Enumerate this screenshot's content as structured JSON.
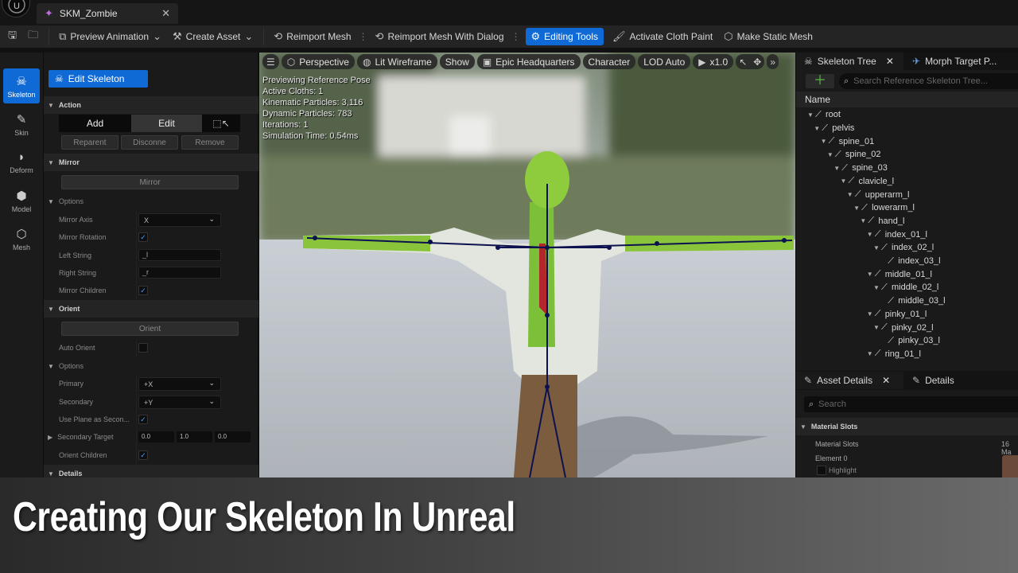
{
  "window": {
    "tab_title": "SKM_Zombie"
  },
  "toolbar": {
    "preview_animation": "Preview Animation",
    "create_asset": "Create Asset",
    "reimport_mesh": "Reimport Mesh",
    "reimport_mesh_dialog": "Reimport Mesh With Dialog",
    "editing_tools": "Editing Tools",
    "activate_cloth_paint": "Activate Cloth Paint",
    "make_static_mesh": "Make Static Mesh"
  },
  "modes": [
    "Skeleton",
    "Skin",
    "Deform",
    "Model",
    "Mesh"
  ],
  "left_panel": {
    "edit_skeleton": "Edit Skeleton",
    "action_header": "Action",
    "add": "Add",
    "edit": "Edit",
    "reparent": "Reparent",
    "disconnect": "Disconne",
    "remove": "Remove",
    "mirror_header": "Mirror",
    "mirror_button": "Mirror",
    "options_header": "Options",
    "mirror_axis_label": "Mirror Axis",
    "mirror_axis_value": "X",
    "mirror_rotation_label": "Mirror Rotation",
    "left_string_label": "Left String",
    "left_string_value": "_l",
    "right_string_label": "Right String",
    "right_string_value": "_r",
    "mirror_children_label": "Mirror Children",
    "orient_header": "Orient",
    "orient_button": "Orient",
    "auto_orient_label": "Auto Orient",
    "options2_header": "Options",
    "primary_label": "Primary",
    "primary_value": "+X",
    "secondary_label": "Secondary",
    "secondary_value": "+Y",
    "use_plane_label": "Use Plane as Secon...",
    "secondary_target_label": "Secondary Target",
    "secondary_target": [
      "0.0",
      "1.0",
      "0.0"
    ],
    "orient_children_label": "Orient Children",
    "details_header": "Details"
  },
  "viewport": {
    "perspective": "Perspective",
    "lit_wireframe": "Lit Wireframe",
    "show": "Show",
    "epic_hq": "Epic Headquarters",
    "character": "Character",
    "lod": "LOD Auto",
    "speed": "x1.0",
    "stats": [
      "Previewing Reference Pose",
      "Active Cloths: 1",
      "Kinematic Particles: 3,116",
      "Dynamic Particles: 783",
      "Iterations: 1",
      "Simulation Time: 0.54ms"
    ]
  },
  "skeleton_tree": {
    "tab": "Skeleton Tree",
    "tab2": "Morph Target P...",
    "search_placeholder": "Search Reference Skeleton Tree...",
    "column": "Name",
    "bones": [
      "root",
      "pelvis",
      "spine_01",
      "spine_02",
      "spine_03",
      "clavicle_l",
      "upperarm_l",
      "lowerarm_l",
      "hand_l",
      "index_01_l",
      "index_02_l",
      "index_03_l",
      "middle_01_l",
      "middle_02_l",
      "middle_03_l",
      "pinky_01_l",
      "pinky_02_l",
      "pinky_03_l",
      "ring_01_l"
    ]
  },
  "asset_details": {
    "tab": "Asset Details",
    "tab2": "Details",
    "search_placeholder": "Search",
    "material_slots_header": "Material Slots",
    "material_slots_label": "Material Slots",
    "material_slots_value": "16 Ma",
    "element0": "Element 0",
    "highlight": "Highlight"
  },
  "caption": "Creating Our Skeleton In Unreal"
}
